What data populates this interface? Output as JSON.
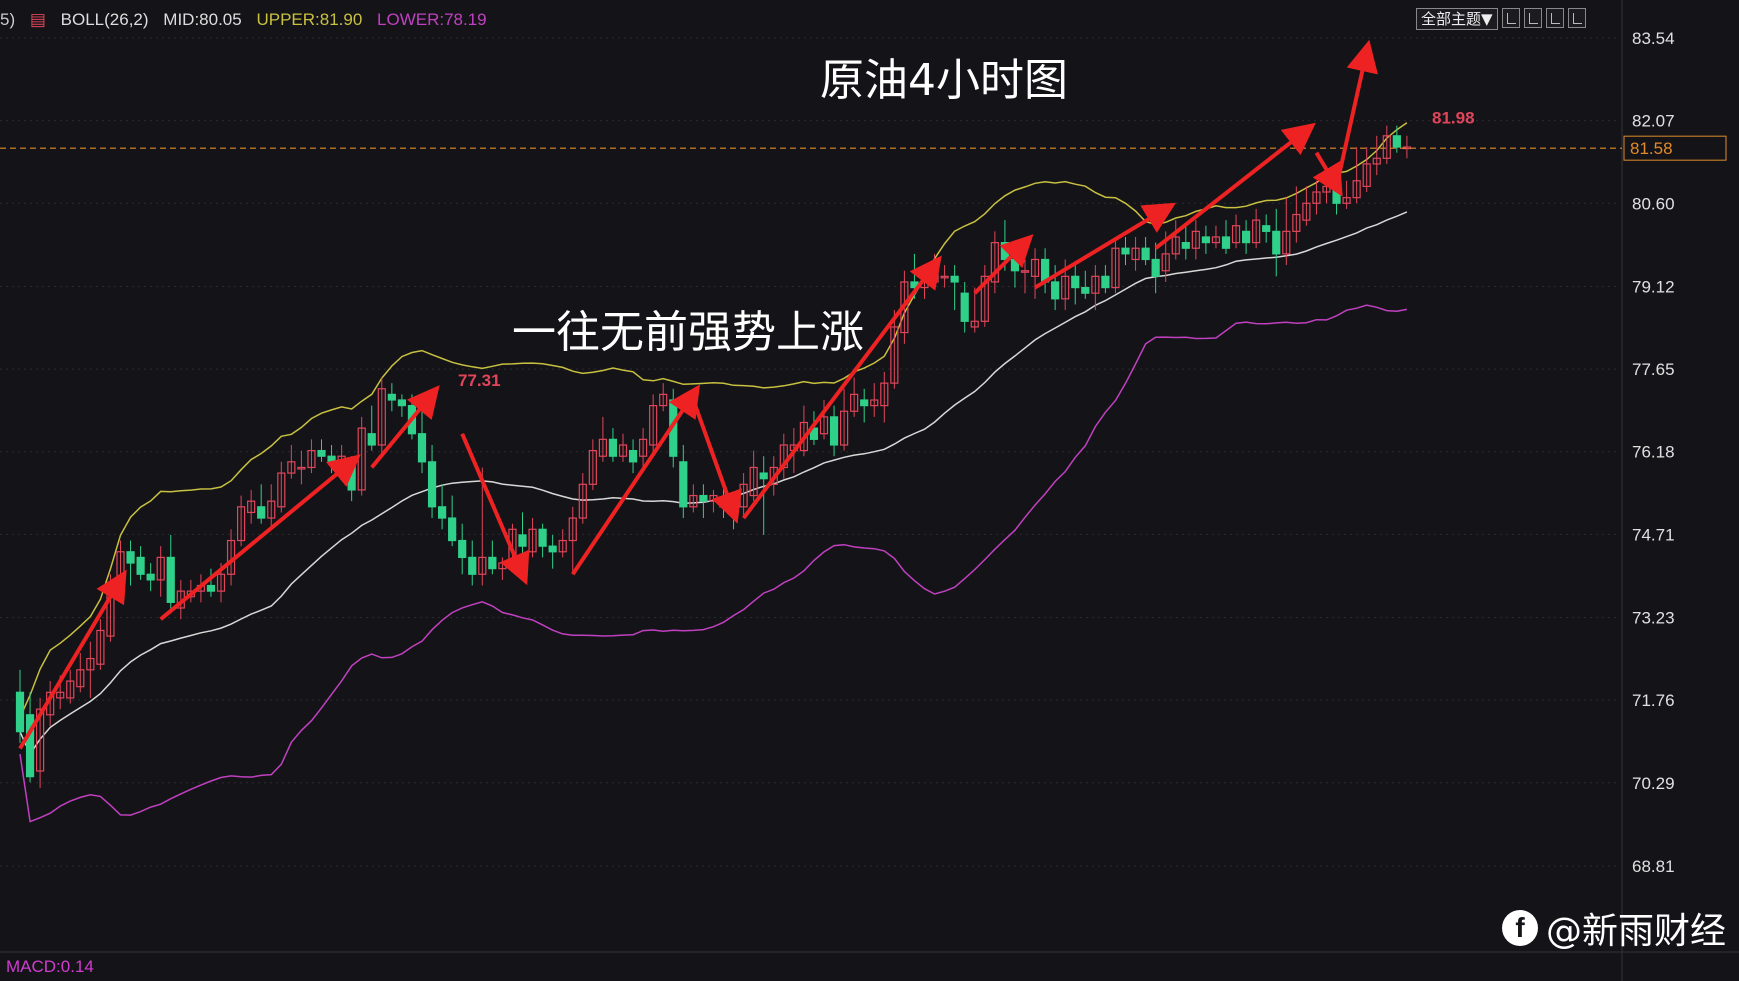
{
  "header": {
    "indicator": "BOLL(26,2)",
    "mid": "MID:80.05",
    "upper": "UPPER:81.90",
    "lower": "LOWER:78.19",
    "left_fragment": "5)"
  },
  "toolbar": {
    "theme_button": "全部主题▼"
  },
  "title": "原油4小时图",
  "annotation": "一往无前强势上涨",
  "macd_label": "MACD:0.14",
  "watermark": "@新雨财经",
  "current_price_label": "81.58",
  "colors": {
    "background": "#141418",
    "up_candle": "#e0455a",
    "down_candle": "#2fd08a",
    "upper_band": "#c8c040",
    "mid_band": "#d8d8d8",
    "lower_band": "#c040c0",
    "arrow": "#ee2222",
    "current_price": "#e08a2a"
  },
  "chart_data": {
    "type": "candlestick",
    "y_ticks": [
      "83.54",
      "82.07",
      "80.60",
      "79.12",
      "77.65",
      "76.18",
      "74.71",
      "73.23",
      "71.76",
      "70.29",
      "68.81"
    ],
    "ylim": [
      68.81,
      83.54
    ],
    "current_price": 81.58,
    "annotations": [
      {
        "label": "77.31",
        "value": 77.31
      },
      {
        "label": "81.98",
        "value": 81.98
      }
    ],
    "candles": [
      [
        71.9,
        71.2,
        72.3,
        71.0
      ],
      [
        71.5,
        70.4,
        71.9,
        70.3
      ],
      [
        70.5,
        71.6,
        71.8,
        70.2
      ],
      [
        71.5,
        71.9,
        72.1,
        71.3
      ],
      [
        71.8,
        71.9,
        72.2,
        71.6
      ],
      [
        71.8,
        72.1,
        72.3,
        71.7
      ],
      [
        72.0,
        72.3,
        72.6,
        71.9
      ],
      [
        72.3,
        72.5,
        72.8,
        71.8
      ],
      [
        72.4,
        73.0,
        73.2,
        72.3
      ],
      [
        72.9,
        73.8,
        74.0,
        72.8
      ],
      [
        73.6,
        74.4,
        74.6,
        73.5
      ],
      [
        74.4,
        74.2,
        74.6,
        73.8
      ],
      [
        74.3,
        74.0,
        74.5,
        73.9
      ],
      [
        74.0,
        73.9,
        74.2,
        73.7
      ],
      [
        73.9,
        74.3,
        74.5,
        73.6
      ],
      [
        74.3,
        73.5,
        74.7,
        73.3
      ],
      [
        73.4,
        73.7,
        73.9,
        73.2
      ],
      [
        73.6,
        73.7,
        73.9,
        73.5
      ],
      [
        73.7,
        73.8,
        74.0,
        73.5
      ],
      [
        73.8,
        73.7,
        74.1,
        73.6
      ],
      [
        73.7,
        74.0,
        74.2,
        73.5
      ],
      [
        74.0,
        74.6,
        74.8,
        73.8
      ],
      [
        74.6,
        75.2,
        75.4,
        74.5
      ],
      [
        75.1,
        75.3,
        75.5,
        74.9
      ],
      [
        75.2,
        75.0,
        75.6,
        74.9
      ],
      [
        75.0,
        75.3,
        75.6,
        74.8
      ],
      [
        75.2,
        75.8,
        76.0,
        75.1
      ],
      [
        75.8,
        76.0,
        76.3,
        75.7
      ],
      [
        75.9,
        75.9,
        76.2,
        75.6
      ],
      [
        75.9,
        76.2,
        76.4,
        75.8
      ],
      [
        76.2,
        76.1,
        76.4,
        76.0
      ],
      [
        76.1,
        76.0,
        76.3,
        75.8
      ],
      [
        76.0,
        76.1,
        76.3,
        75.9
      ],
      [
        76.0,
        75.5,
        76.1,
        75.3
      ],
      [
        75.5,
        76.6,
        76.8,
        75.4
      ],
      [
        76.5,
        76.3,
        77.0,
        76.2
      ],
      [
        76.3,
        77.3,
        77.5,
        76.1
      ],
      [
        77.2,
        77.1,
        77.4,
        76.9
      ],
      [
        77.1,
        77.0,
        77.2,
        76.8
      ],
      [
        77.0,
        76.5,
        77.2,
        76.4
      ],
      [
        76.5,
        76.0,
        76.9,
        75.8
      ],
      [
        76.0,
        75.2,
        76.3,
        75.0
      ],
      [
        75.2,
        75.0,
        75.6,
        74.8
      ],
      [
        75.0,
        74.6,
        75.4,
        74.5
      ],
      [
        74.6,
        74.3,
        74.9,
        74.0
      ],
      [
        74.3,
        74.0,
        74.6,
        73.8
      ],
      [
        74.0,
        74.3,
        75.9,
        73.8
      ],
      [
        74.3,
        74.1,
        74.6,
        74.0
      ],
      [
        74.1,
        74.2,
        74.3,
        73.9
      ],
      [
        74.2,
        74.8,
        74.9,
        74.2
      ],
      [
        74.7,
        74.5,
        75.1,
        74.3
      ],
      [
        74.4,
        74.8,
        75.0,
        74.3
      ],
      [
        74.8,
        74.5,
        74.9,
        74.3
      ],
      [
        74.5,
        74.4,
        74.7,
        74.1
      ],
      [
        74.4,
        74.6,
        74.8,
        74.3
      ],
      [
        74.6,
        75.0,
        75.2,
        74.0
      ],
      [
        75.0,
        75.6,
        75.8,
        74.9
      ],
      [
        75.6,
        76.2,
        76.4,
        75.5
      ],
      [
        76.1,
        76.4,
        76.8,
        76.0
      ],
      [
        76.4,
        76.1,
        76.6,
        76.0
      ],
      [
        76.1,
        76.3,
        76.5,
        76.0
      ],
      [
        76.2,
        76.0,
        76.4,
        75.8
      ],
      [
        76.1,
        76.4,
        76.6,
        75.9
      ],
      [
        76.3,
        77.0,
        77.2,
        76.1
      ],
      [
        77.0,
        77.2,
        77.4,
        76.9
      ],
      [
        77.1,
        76.1,
        77.3,
        75.9
      ],
      [
        76.0,
        75.2,
        76.3,
        75.0
      ],
      [
        75.2,
        75.4,
        75.6,
        75.1
      ],
      [
        75.4,
        75.3,
        75.6,
        75.0
      ],
      [
        75.3,
        75.4,
        75.5,
        75.1
      ],
      [
        75.3,
        75.2,
        75.6,
        75.0
      ],
      [
        75.2,
        75.1,
        75.3,
        74.8
      ],
      [
        75.2,
        75.6,
        75.8,
        75.0
      ],
      [
        75.4,
        75.9,
        76.2,
        75.3
      ],
      [
        75.8,
        75.7,
        76.1,
        74.7
      ],
      [
        75.6,
        75.9,
        76.1,
        75.4
      ],
      [
        75.9,
        76.3,
        76.5,
        75.7
      ],
      [
        76.2,
        76.3,
        76.6,
        75.8
      ],
      [
        76.2,
        76.7,
        77.0,
        76.1
      ],
      [
        76.6,
        76.4,
        76.9,
        76.3
      ],
      [
        76.5,
        76.8,
        77.1,
        76.4
      ],
      [
        76.8,
        76.3,
        77.0,
        76.1
      ],
      [
        76.3,
        76.9,
        77.3,
        76.2
      ],
      [
        76.9,
        77.2,
        77.5,
        76.8
      ],
      [
        77.1,
        77.0,
        77.3,
        76.7
      ],
      [
        77.0,
        77.1,
        77.4,
        76.8
      ],
      [
        77.0,
        77.4,
        77.6,
        76.7
      ],
      [
        77.4,
        78.4,
        78.7,
        77.3
      ],
      [
        78.3,
        79.2,
        79.4,
        78.1
      ],
      [
        79.2,
        79.1,
        79.7,
        78.9
      ],
      [
        79.1,
        79.2,
        79.4,
        78.9
      ],
      [
        79.2,
        79.4,
        79.7,
        79.1
      ],
      [
        79.3,
        79.3,
        79.5,
        79.1
      ],
      [
        79.3,
        79.2,
        79.5,
        78.7
      ],
      [
        79.0,
        78.5,
        79.2,
        78.3
      ],
      [
        78.4,
        78.5,
        79.1,
        78.3
      ],
      [
        78.5,
        79.3,
        79.5,
        78.4
      ],
      [
        79.2,
        79.9,
        80.1,
        79.0
      ],
      [
        79.9,
        79.6,
        80.3,
        79.4
      ],
      [
        79.6,
        79.4,
        79.8,
        79.1
      ],
      [
        79.4,
        79.4,
        79.6,
        79.0
      ],
      [
        79.3,
        79.6,
        79.8,
        78.9
      ],
      [
        79.6,
        79.2,
        79.8,
        79.0
      ],
      [
        79.2,
        78.9,
        79.5,
        78.7
      ],
      [
        78.9,
        79.3,
        79.6,
        78.7
      ],
      [
        79.3,
        79.1,
        79.5,
        78.8
      ],
      [
        79.1,
        79.0,
        79.4,
        78.9
      ],
      [
        79.0,
        79.3,
        79.5,
        78.7
      ],
      [
        79.3,
        79.1,
        79.5,
        79.0
      ],
      [
        79.1,
        79.8,
        80.0,
        79.0
      ],
      [
        79.8,
        79.7,
        80.0,
        79.5
      ],
      [
        79.6,
        79.8,
        80.0,
        79.4
      ],
      [
        79.8,
        79.6,
        80.0,
        79.5
      ],
      [
        79.6,
        79.3,
        79.9,
        79.0
      ],
      [
        79.4,
        79.7,
        80.1,
        79.2
      ],
      [
        79.7,
        80.0,
        80.3,
        79.6
      ],
      [
        79.9,
        79.8,
        80.2,
        79.6
      ],
      [
        79.8,
        80.1,
        80.3,
        79.6
      ],
      [
        80.0,
        79.9,
        80.2,
        79.7
      ],
      [
        79.9,
        80.0,
        80.2,
        79.8
      ],
      [
        80.0,
        79.8,
        80.3,
        79.7
      ],
      [
        79.9,
        80.2,
        80.4,
        79.8
      ],
      [
        80.1,
        79.9,
        80.3,
        79.7
      ],
      [
        79.9,
        80.3,
        80.5,
        79.8
      ],
      [
        80.2,
        80.1,
        80.4,
        79.9
      ],
      [
        80.1,
        79.7,
        80.5,
        79.3
      ],
      [
        79.7,
        80.1,
        80.7,
        79.5
      ],
      [
        80.1,
        80.4,
        80.9,
        79.9
      ],
      [
        80.3,
        80.6,
        80.9,
        80.2
      ],
      [
        80.6,
        80.8,
        81.0,
        80.4
      ],
      [
        80.8,
        80.9,
        81.1,
        80.6
      ],
      [
        80.9,
        80.6,
        81.2,
        80.4
      ],
      [
        80.6,
        80.7,
        81.0,
        80.5
      ],
      [
        80.7,
        81.0,
        81.6,
        80.6
      ],
      [
        80.9,
        81.3,
        81.6,
        80.8
      ],
      [
        81.3,
        81.4,
        81.8,
        81.1
      ],
      [
        81.4,
        81.8,
        81.98,
        81.3
      ],
      [
        81.8,
        81.6,
        81.98,
        81.5
      ],
      [
        81.6,
        81.6,
        81.8,
        81.4
      ]
    ],
    "bands_note": "BOLL(26,2)"
  }
}
